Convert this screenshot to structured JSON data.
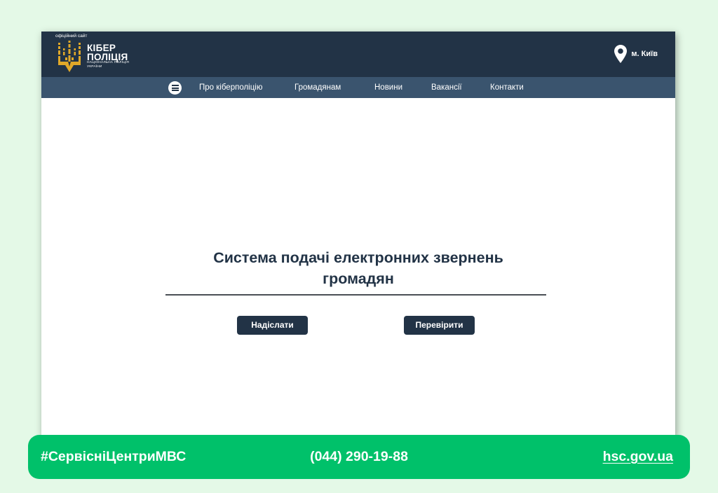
{
  "header": {
    "official_label": "офіційний сайт",
    "logo_line1": "КІБЕР",
    "logo_line2": "ПОЛІЦІЯ",
    "logo_sub1": "НАЦІОНАЛЬНА ПОЛІЦІЯ",
    "logo_sub2": "УКРАЇНИ",
    "location": "м. Київ"
  },
  "nav": {
    "items": [
      {
        "label": "Про кіберполіцію"
      },
      {
        "label": "Громадянам"
      },
      {
        "label": "Новини"
      },
      {
        "label": "Вакансії"
      },
      {
        "label": "Контакти"
      }
    ]
  },
  "main": {
    "title_line1": "Система подачі електронних звернень",
    "title_line2": "громадян",
    "submit_button": "Надіслати",
    "check_button": "Перевірити"
  },
  "banner": {
    "hashtag": "#СервісніЦентриМВС",
    "phone": "(044) 290-19-88",
    "site": "hsc.gov.ua"
  },
  "colors": {
    "page_background": "#e4f9e7",
    "header_dark": "#223346",
    "nav_blue": "#3a546e",
    "logo_gold": "#e0a829",
    "banner_green": "#00c16a",
    "button_dark": "#223346"
  },
  "icons": [
    "menu-icon",
    "location-pin-icon",
    "trident-emblem"
  ]
}
